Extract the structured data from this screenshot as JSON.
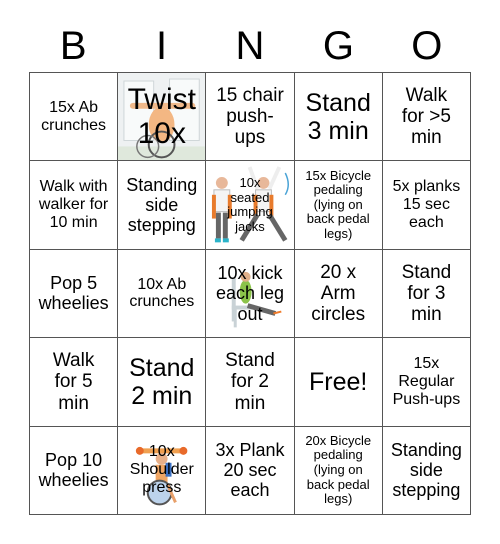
{
  "header": {
    "letters": [
      "B",
      "I",
      "N",
      "G",
      "O"
    ]
  },
  "cells": [
    {
      "text": "15x Ab\ncrunches",
      "size": "s16"
    },
    {
      "text": "Twist\n10x",
      "size": "s30",
      "image": "wheelchair-twist-illustration"
    },
    {
      "text": "15 chair\npush-\nups",
      "size": "s19"
    },
    {
      "text": "Stand\n3 min",
      "size": "s24"
    },
    {
      "text": "Walk\nfor >5\nmin",
      "size": "s19"
    },
    {
      "text": "Walk with\nwalker for\n10 min",
      "size": "s16"
    },
    {
      "text": "Standing\nside\nstepping",
      "size": "s18"
    },
    {
      "text": "10x\nseated\njumping\njacks",
      "size": "s13",
      "image": "seated-jumping-jacks-illustration"
    },
    {
      "text": "15x Bicycle\npedaling\n(lying on\nback pedal\nlegs)",
      "size": "s13x"
    },
    {
      "text": "5x planks\n15 sec\neach",
      "size": "s16"
    },
    {
      "text": "Pop 5\nwheelies",
      "size": "s18"
    },
    {
      "text": "10x Ab\ncrunches",
      "size": "s16"
    },
    {
      "text": "10x kick\neach leg\nout",
      "size": "s18",
      "image": "seated-leg-kick-illustration"
    },
    {
      "text": "20 x\nArm\ncircles",
      "size": "s19"
    },
    {
      "text": "Stand\nfor 3\nmin",
      "size": "s19"
    },
    {
      "text": "Walk\nfor 5\nmin",
      "size": "s19"
    },
    {
      "text": "Stand\n2 min",
      "size": "s24"
    },
    {
      "text": "Stand\nfor 2\nmin",
      "size": "s19"
    },
    {
      "text": "Free!",
      "size": "s24"
    },
    {
      "text": "15x\nRegular\nPush-ups",
      "size": "s16"
    },
    {
      "text": "Pop 10\nwheelies",
      "size": "s18"
    },
    {
      "text": "10x\nShoulder\npress",
      "size": "s16",
      "image": "wheelchair-shoulder-press-illustration"
    },
    {
      "text": "3x Plank\n20 sec\neach",
      "size": "s18"
    },
    {
      "text": "20x Bicycle\npedaling\n(lying on\nback pedal\nlegs)",
      "size": "s13x"
    },
    {
      "text": "Standing\nside\nstepping",
      "size": "s18"
    }
  ]
}
